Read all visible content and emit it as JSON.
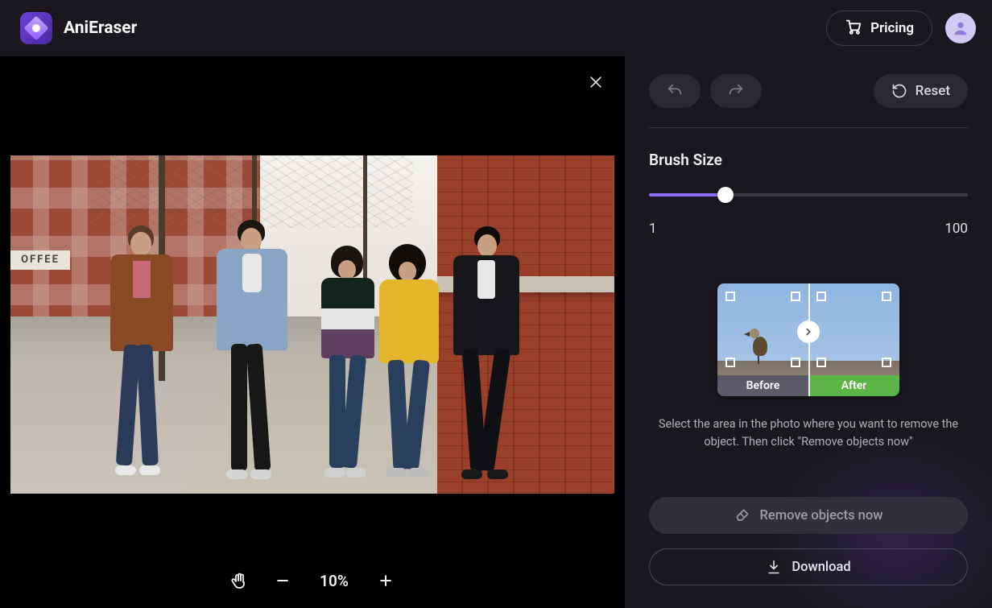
{
  "header": {
    "app_name": "AniEraser",
    "pricing_label": "Pricing"
  },
  "canvas": {
    "coffee_sign": "OFFEE",
    "zoom": {
      "value_label": "10%"
    }
  },
  "panel": {
    "reset_label": "Reset",
    "brush": {
      "title": "Brush Size",
      "min_label": "1",
      "max_label": "100",
      "min": 1,
      "max": 100,
      "value": 24
    },
    "demo": {
      "before_label": "Before",
      "after_label": "After"
    },
    "instruction": "Select the area in the photo where you want to remove the object. Then click \"Remove objects now\"",
    "remove_label": "Remove objects now",
    "download_label": "Download"
  }
}
